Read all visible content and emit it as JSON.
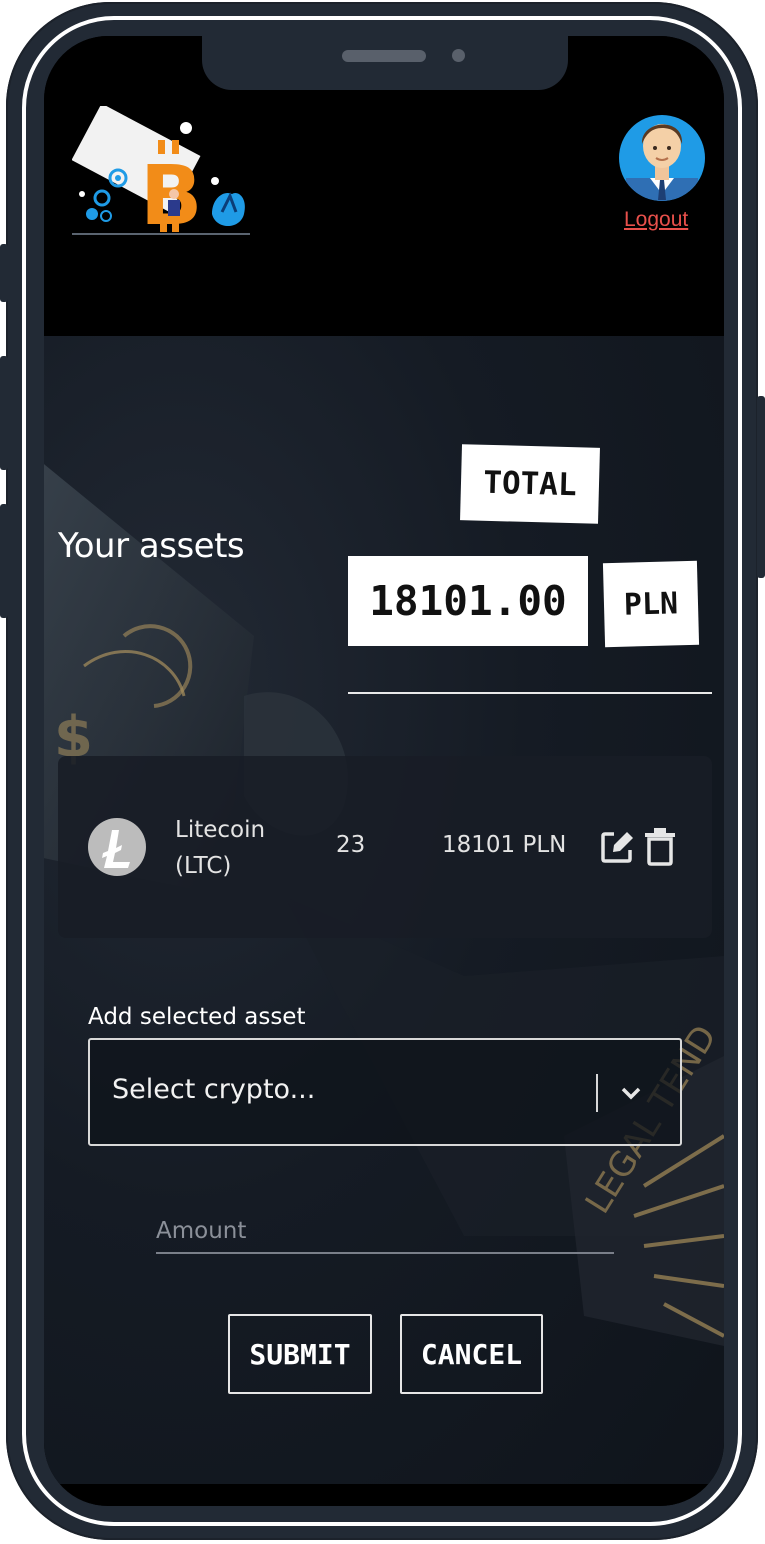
{
  "header": {
    "logo_icon": "bitcoin-logo-illustration",
    "avatar_icon": "user-avatar",
    "logout_label": "Logout"
  },
  "portfolio": {
    "title": "Your assets",
    "total_label": "TOTAL",
    "total_amount": "18101.00",
    "currency": "PLN"
  },
  "assets": [
    {
      "icon": "litecoin-icon",
      "name": "Litecoin (LTC)",
      "quantity": "23",
      "value": "18101 PLN"
    }
  ],
  "form": {
    "label": "Add selected asset",
    "select_placeholder": "Select crypto...",
    "amount_placeholder": "Amount",
    "submit_label": "SUBMIT",
    "cancel_label": "CANCEL"
  },
  "colors": {
    "logout": "#e8504b",
    "bitcoin_orange": "#f28c18",
    "accent_blue": "#1f9be6"
  }
}
